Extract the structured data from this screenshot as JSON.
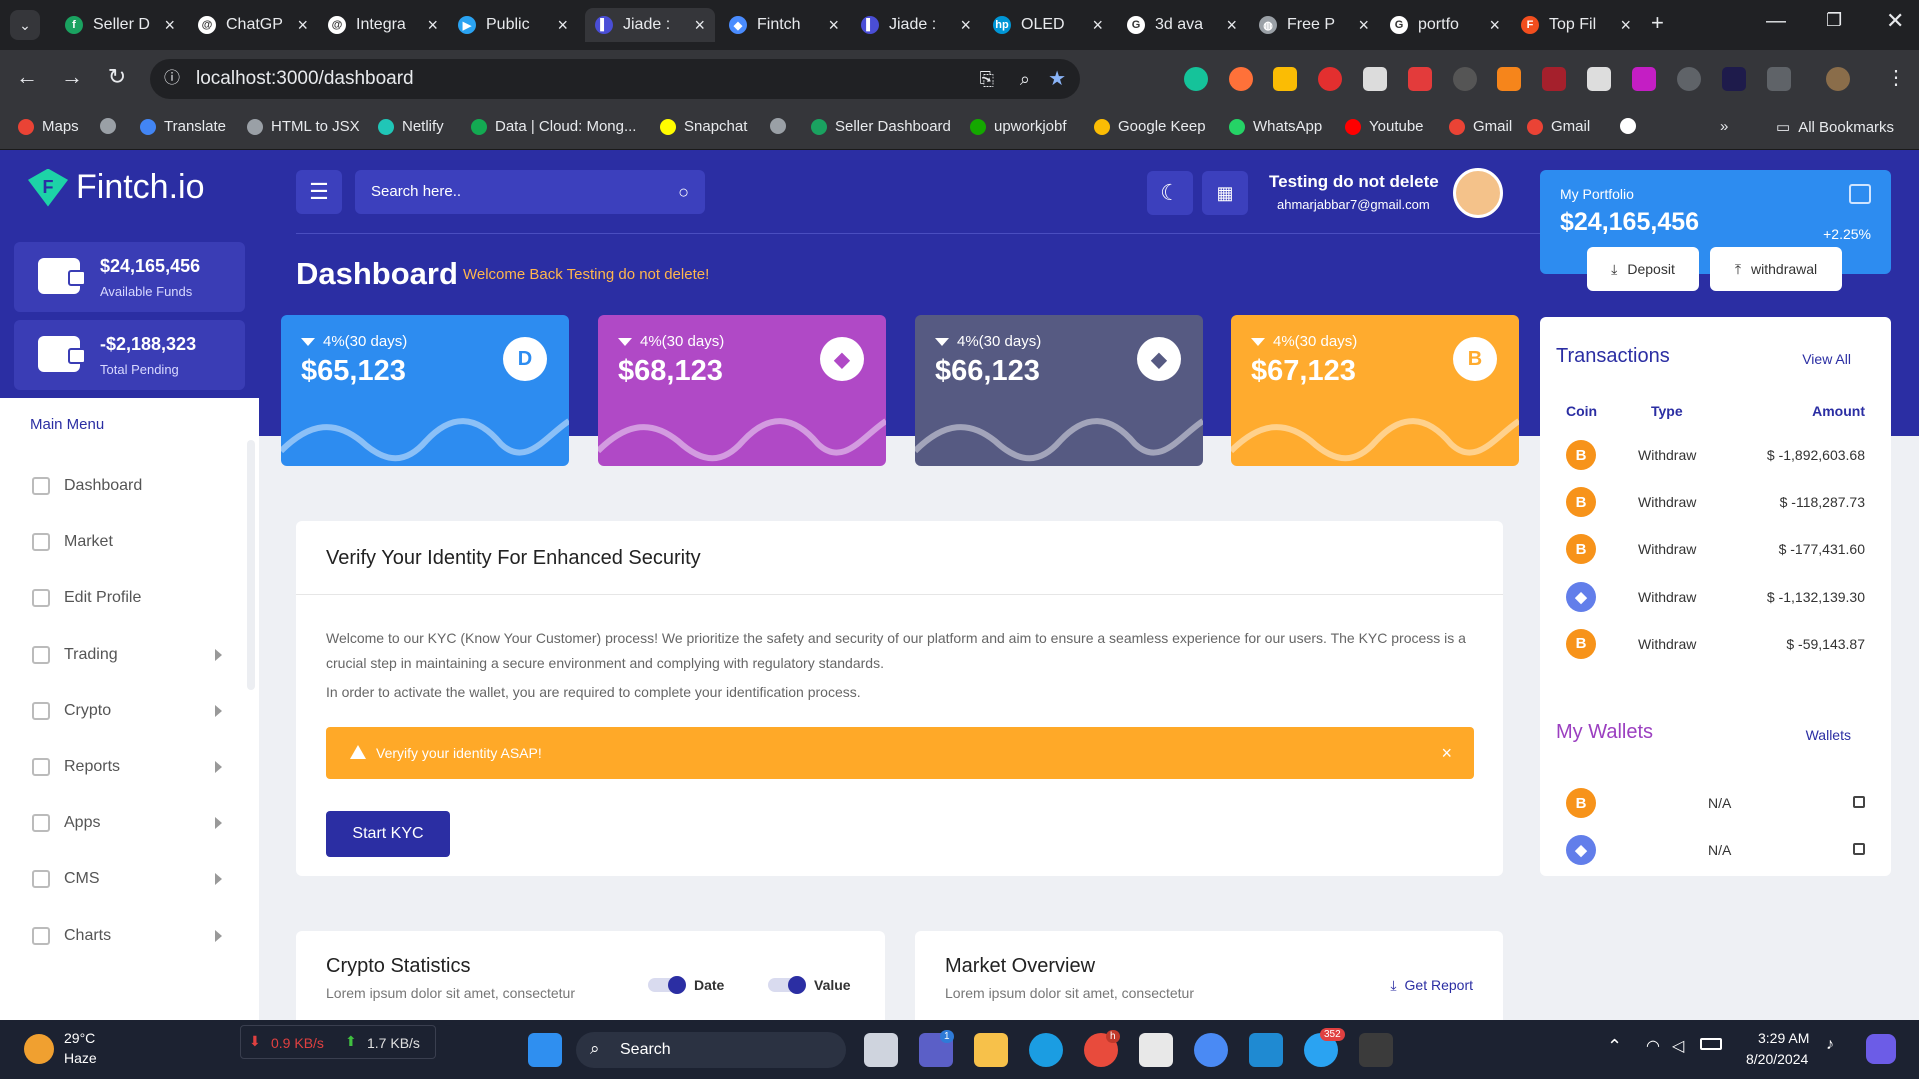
{
  "browser": {
    "tabs": [
      {
        "title": "Seller D",
        "color": "#1aa260",
        "glyph": "f"
      },
      {
        "title": "ChatGP",
        "color": "#ffffff",
        "glyph": "@"
      },
      {
        "title": "Integra",
        "color": "#ffffff",
        "glyph": "@"
      },
      {
        "title": "Public",
        "color": "#2aa3f2",
        "glyph": "▶"
      },
      {
        "title": "Jiade :",
        "color": "#4a4ed6",
        "glyph": "▌"
      },
      {
        "title": "Fintch",
        "color": "#4a8cff",
        "glyph": "◆"
      },
      {
        "title": "Jiade :",
        "color": "#4a4ed6",
        "glyph": "▌"
      },
      {
        "title": "OLED",
        "color": "#0096d6",
        "glyph": "hp"
      },
      {
        "title": "3d ava",
        "color": "#ffffff",
        "glyph": "G"
      },
      {
        "title": "Free P",
        "color": "#9aa0a6",
        "glyph": "◍"
      },
      {
        "title": "portfo",
        "color": "#ffffff",
        "glyph": "G"
      },
      {
        "title": "Top Fil",
        "color": "#f24e1e",
        "glyph": "F"
      }
    ],
    "url": "localhost:3000/dashboard",
    "bookmarks": [
      {
        "label": "Maps",
        "color": "#ea4335"
      },
      {
        "label": "",
        "color": "#9aa0a6"
      },
      {
        "label": "Translate",
        "color": "#4285f4"
      },
      {
        "label": "HTML to JSX",
        "color": "#9aa0a6"
      },
      {
        "label": "Netlify",
        "color": "#20c6b7"
      },
      {
        "label": "Data | Cloud: Mong...",
        "color": "#13aa52"
      },
      {
        "label": "Snapchat",
        "color": "#fffc00"
      },
      {
        "label": "",
        "color": "#9aa0a6"
      },
      {
        "label": "Seller Dashboard",
        "color": "#1aa260"
      },
      {
        "label": "upworkjobf",
        "color": "#14a800"
      },
      {
        "label": "Google Keep",
        "color": "#fbbc04"
      },
      {
        "label": "WhatsApp",
        "color": "#25d366"
      },
      {
        "label": "Youtube",
        "color": "#ff0000"
      },
      {
        "label": "Gmail",
        "color": "#ea4335"
      },
      {
        "label": "Gmail",
        "color": "#ea4335"
      },
      {
        "label": "",
        "color": "#ffffff"
      }
    ],
    "all_bookmarks": "All Bookmarks"
  },
  "sidebar": {
    "brand": "Fintch.io",
    "funds": [
      {
        "amount": "$24,165,456",
        "label": "Available Funds"
      },
      {
        "amount": "-$2,188,323",
        "label": "Total Pending"
      }
    ],
    "main_menu": "Main Menu",
    "items": [
      {
        "label": "Dashboard",
        "has_arrow": false
      },
      {
        "label": "Market",
        "has_arrow": false
      },
      {
        "label": "Edit Profile",
        "has_arrow": false
      },
      {
        "label": "Trading",
        "has_arrow": true
      },
      {
        "label": "Crypto",
        "has_arrow": true
      },
      {
        "label": "Reports",
        "has_arrow": true
      },
      {
        "label": "Apps",
        "has_arrow": true
      },
      {
        "label": "CMS",
        "has_arrow": true
      },
      {
        "label": "Charts",
        "has_arrow": true
      }
    ]
  },
  "header": {
    "search_placeholder": "Search here..",
    "user_name": "Testing do not delete",
    "user_email": "ahmarjabbar7@gmail.com",
    "title": "Dashboard",
    "welcome": "Welcome Back Testing do not delete!"
  },
  "coin_cards": [
    {
      "change": "4%(30 days)",
      "value": "$65,123",
      "bg": "#2d8cf0",
      "icon_glyph": "D",
      "icon_color": "#2d8cf0"
    },
    {
      "change": "4%(30 days)",
      "value": "$68,123",
      "bg": "#b049c6",
      "icon_glyph": "◆",
      "icon_color": "#b049c6"
    },
    {
      "change": "4%(30 days)",
      "value": "$66,123",
      "bg": "#565a82",
      "icon_glyph": "◆",
      "icon_color": "#565a82"
    },
    {
      "change": "4%(30 days)",
      "value": "$67,123",
      "bg": "#ffab2e",
      "icon_glyph": "B",
      "icon_color": "#ffab2e"
    }
  ],
  "portfolio": {
    "label": "My Portfolio",
    "value": "$24,165,456",
    "change": "+2.25%",
    "deposit": "Deposit",
    "withdrawal": "withdrawal"
  },
  "kyc": {
    "title": "Verify Your Identity For Enhanced Security",
    "paragraph1": "Welcome to our KYC (Know Your Customer) process! We prioritize the safety and security of our platform and aim to ensure a seamless experience for our users. The KYC process is a crucial step in maintaining a secure environment and complying with regulatory standards.",
    "paragraph2": "In order to activate the wallet, you are required to complete your identification process.",
    "alert": "Veryify your identity ASAP!",
    "alert_close": "×",
    "button": "Start KYC"
  },
  "crypto_stats": {
    "title": "Crypto Statistics",
    "subtitle": "Lorem ipsum dolor sit amet, consectetur",
    "toggle_date": "Date",
    "toggle_value": "Value"
  },
  "market_overview": {
    "title": "Market Overview",
    "subtitle": "Lorem ipsum dolor sit amet, consectetur",
    "report": "Get Report"
  },
  "transactions": {
    "title": "Transactions",
    "view_all": "View All",
    "headers": {
      "coin": "Coin",
      "type": "Type",
      "amount": "Amount"
    },
    "rows": [
      {
        "coin": "btc",
        "type": "Withdraw",
        "amount": "$ -1,892,603.68"
      },
      {
        "coin": "btc",
        "type": "Withdraw",
        "amount": "$ -118,287.73"
      },
      {
        "coin": "btc",
        "type": "Withdraw",
        "amount": "$ -177,431.60"
      },
      {
        "coin": "eth",
        "type": "Withdraw",
        "amount": "$ -1,132,139.30"
      },
      {
        "coin": "btc",
        "type": "Withdraw",
        "amount": "$ -59,143.87"
      }
    ]
  },
  "wallets": {
    "title": "My Wallets",
    "link": "Wallets",
    "rows": [
      {
        "coin": "btc",
        "address": "N/A"
      },
      {
        "coin": "eth",
        "address": "N/A"
      }
    ]
  },
  "taskbar": {
    "weather_temp": "29°C",
    "weather_desc": "Haze",
    "net_down": "0.9 KB/s",
    "net_up": "1.7 KB/s",
    "search": "Search",
    "time": "3:29 AM",
    "date": "8/20/2024",
    "teams_badge": "1",
    "telegram_badge": "352",
    "chrome_badge": "h"
  }
}
